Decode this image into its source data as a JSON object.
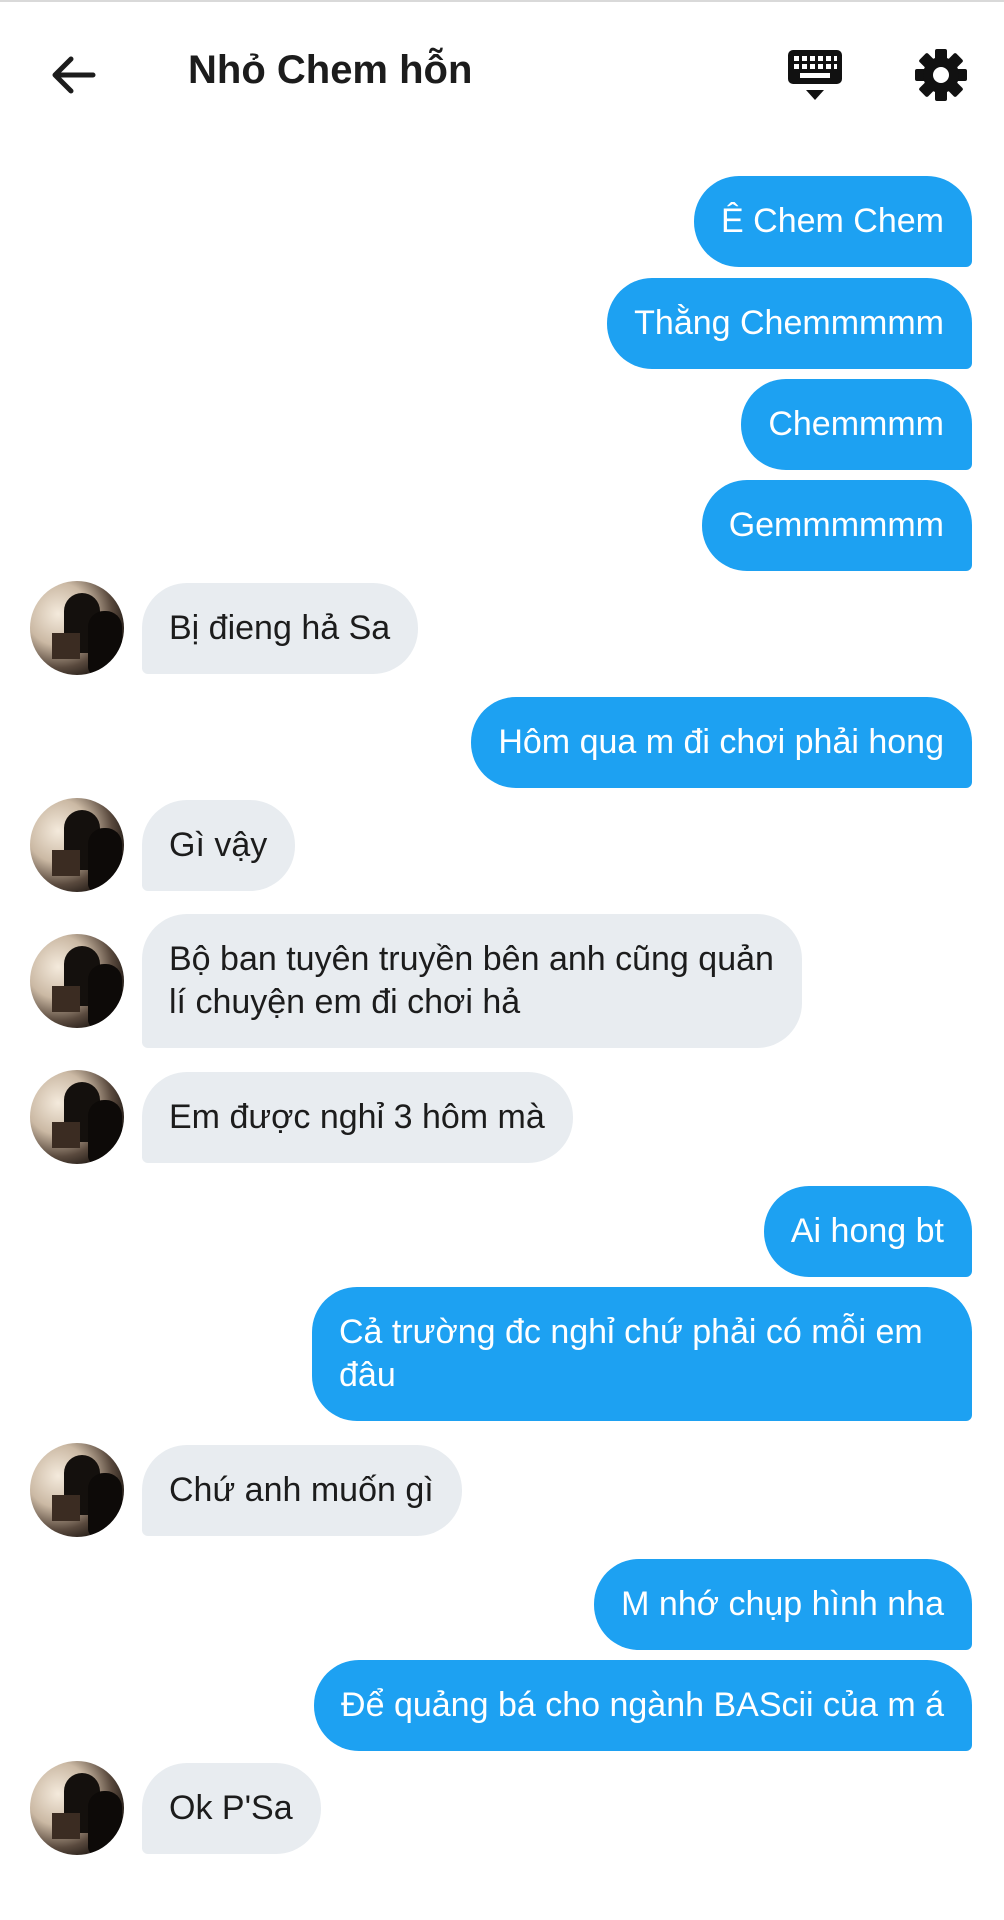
{
  "header": {
    "title": "Nhỏ Chem hỗn"
  },
  "messages": [
    {
      "side": "out",
      "text": "Ê Chem Chem"
    },
    {
      "side": "out",
      "text": "Thằng Chemmmmm"
    },
    {
      "side": "out",
      "text": "Chemmmm"
    },
    {
      "side": "out",
      "text": "Gemmmmmm"
    },
    {
      "side": "in",
      "text": "Bị đieng hả Sa"
    },
    {
      "side": "out",
      "text": "Hôm qua m đi chơi phải hong"
    },
    {
      "side": "in",
      "text": "Gì vậy"
    },
    {
      "side": "in",
      "text": "Bộ ban tuyên truyền bên anh cũng quản lí chuyện em đi chơi hả"
    },
    {
      "side": "in",
      "text": "Em được nghỉ 3 hôm mà"
    },
    {
      "side": "out",
      "text": "Ai hong bt"
    },
    {
      "side": "out",
      "text": "Cả trường đc nghỉ chứ phải có mỗi em đâu"
    },
    {
      "side": "in",
      "text": "Chứ anh muốn gì"
    },
    {
      "side": "out",
      "text": "M nhớ chụp hình nha"
    },
    {
      "side": "out",
      "text": " Để quảng bá cho ngành BAScii của m á"
    },
    {
      "side": "in",
      "text": "Ok P'Sa"
    }
  ],
  "icons": {
    "back": "arrow-left-icon",
    "keyboard": "keyboard-icon",
    "settings": "gear-icon"
  },
  "colors": {
    "outgoing_bubble": "#1da1f2",
    "incoming_bubble": "#e8ecf0",
    "text_dark": "#1c1c1c"
  }
}
